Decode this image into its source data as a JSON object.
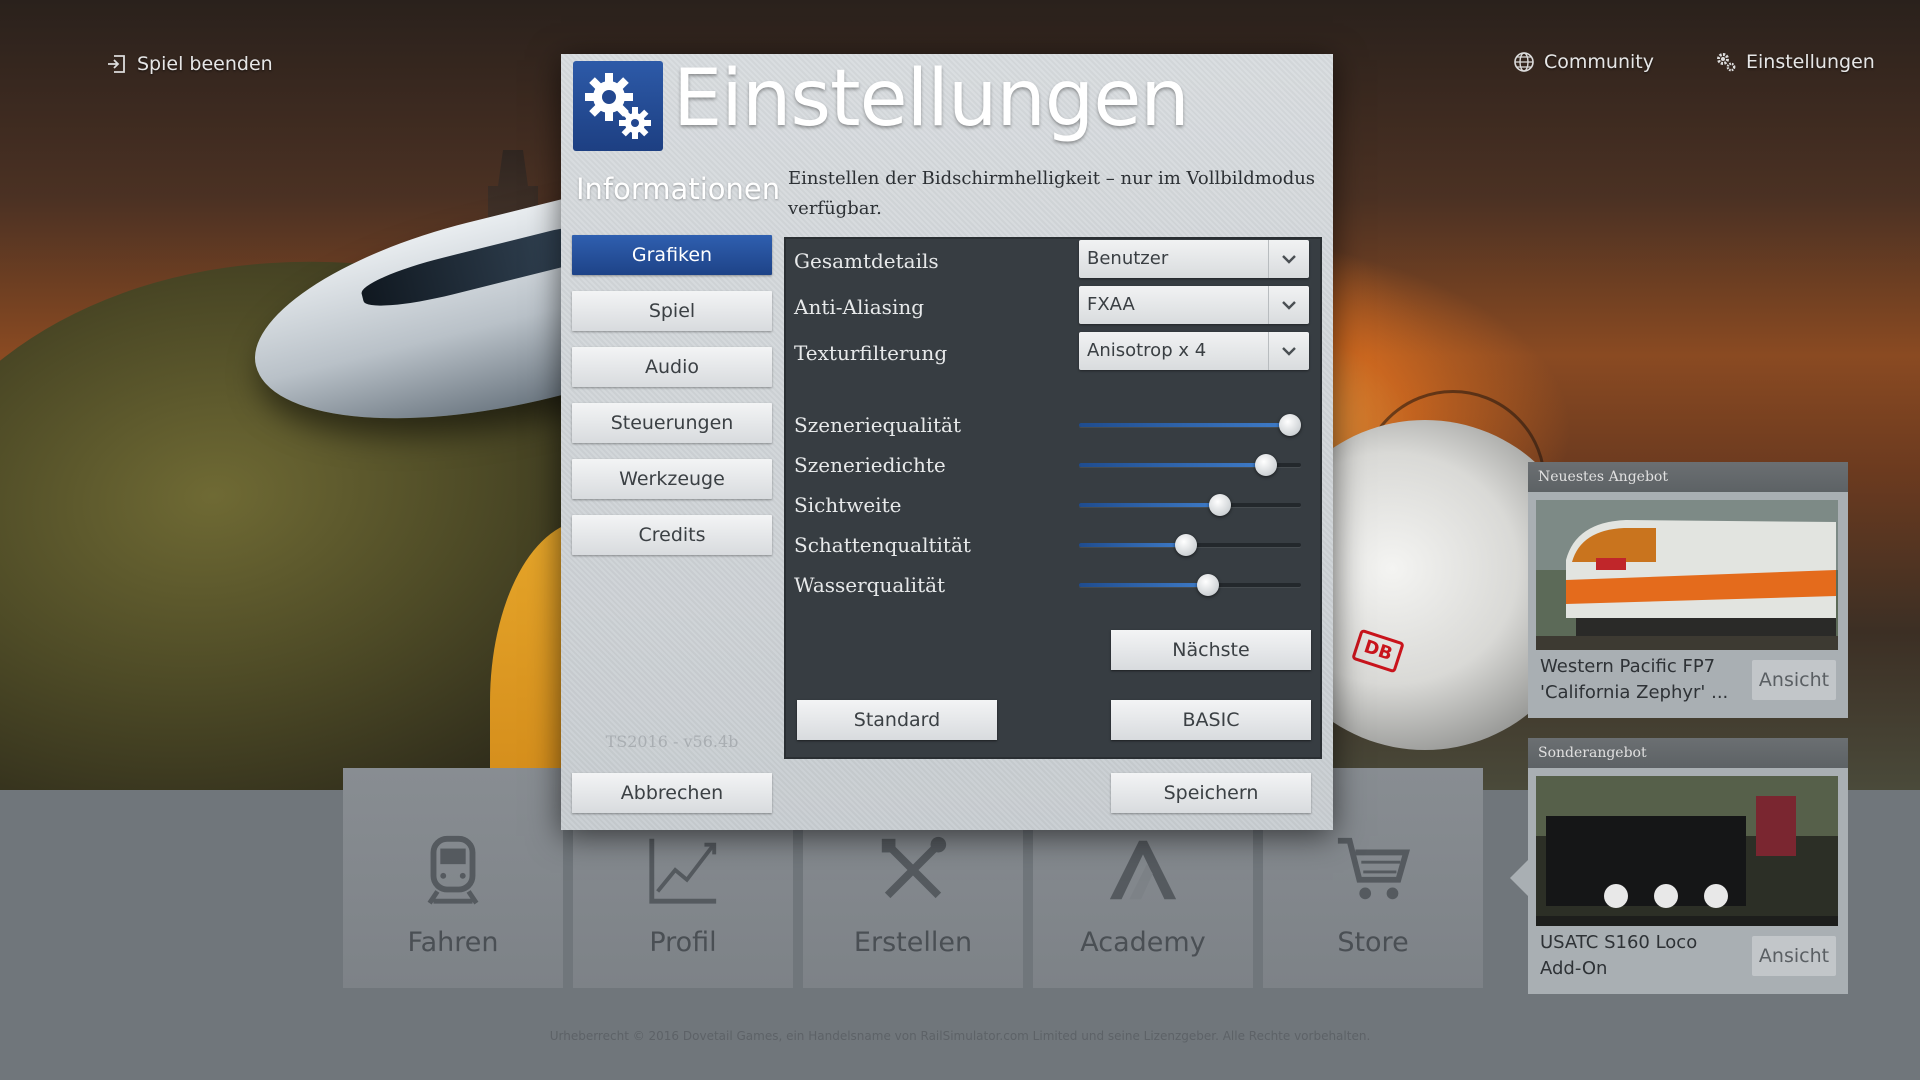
{
  "topbar": {
    "quit_label": "Spiel beenden",
    "community_label": "Community",
    "settings_label": "Einstellungen"
  },
  "dialog": {
    "title": "Einstellungen",
    "section_title": "Informationen",
    "description": "Einstellen der Bidschirmhelligkeit – nur im Vollbildmodus verfügbar.",
    "nav": [
      {
        "label": "Grafiken",
        "active": true
      },
      {
        "label": "Spiel",
        "active": false
      },
      {
        "label": "Audio",
        "active": false
      },
      {
        "label": "Steuerungen",
        "active": false
      },
      {
        "label": "Werkzeuge",
        "active": false
      },
      {
        "label": "Credits",
        "active": false
      }
    ],
    "version": "TS2016 - v56.4b",
    "cancel_label": "Abbrechen",
    "save_label": "Speichern",
    "selects": [
      {
        "label": "Gesamtdetails",
        "value": "Benutzer"
      },
      {
        "label": "Anti-Aliasing",
        "value": "FXAA"
      },
      {
        "label": "Texturfilterung",
        "value": "Anisotrop x 4"
      }
    ],
    "sliders": [
      {
        "label": "Szeneriequalität",
        "level": 1.0
      },
      {
        "label": "Szeneriedichte",
        "level": 0.88
      },
      {
        "label": "Sichtweite",
        "level": 0.65
      },
      {
        "label": "Schattenqualtität",
        "level": 0.48
      },
      {
        "label": "Wasserqualität",
        "level": 0.59
      }
    ],
    "next_label": "Nächste",
    "default_label": "Standard",
    "basic_label": "BASIC",
    "accent_color": "#2a55a3"
  },
  "tiles": [
    {
      "label": "Fahren",
      "icon": "train-icon"
    },
    {
      "label": "Profil",
      "icon": "chart-icon"
    },
    {
      "label": "Erstellen",
      "icon": "tools-icon"
    },
    {
      "label": "Academy",
      "icon": "academy-icon"
    },
    {
      "label": "Store",
      "icon": "cart-icon"
    }
  ],
  "offers": [
    {
      "heading": "Neuestes Angebot",
      "title": "Western Pacific FP7 'California Zephyr' ...",
      "button": "Ansicht"
    },
    {
      "heading": "Sonderangebot",
      "title": "USATC S160 Loco Add-On",
      "button": "Ansicht"
    }
  ],
  "footer": {
    "copyright": "Urheberrecht © 2016 Dovetail Games, ein Handelsname von RailSimulator.com Limited und seine Lizenzgeber. Alle Rechte vorbehalten."
  }
}
